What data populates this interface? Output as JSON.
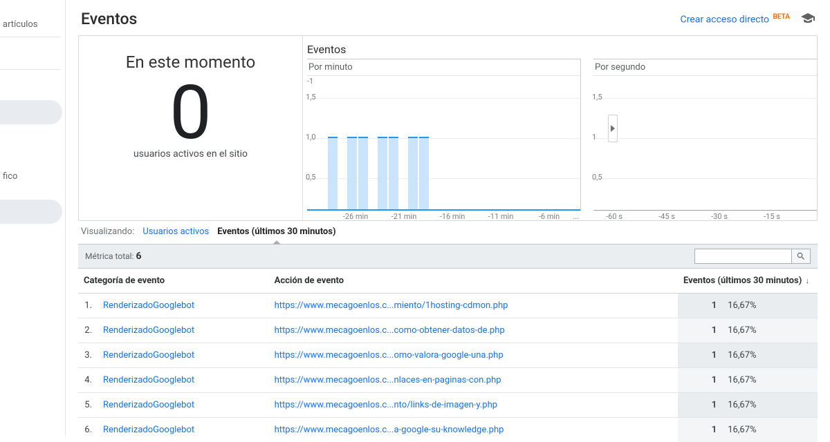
{
  "sidebar": {
    "item_articles": "artículos",
    "item_traffic": "fico"
  },
  "header": {
    "title": "Eventos",
    "shortcut": "Crear acceso directo",
    "beta": "BETA"
  },
  "realtime": {
    "title": "En este momento",
    "count": "0",
    "sub": "usuarios activos en el sitio"
  },
  "charts": {
    "heading": "Eventos",
    "per_minute": "Por minuto",
    "per_second": "Por segundo",
    "y15": "1,5",
    "y10": "1,0",
    "y05": "0,5",
    "y1": "1",
    "ym1": "-1",
    "min_ticks": [
      "-26 min",
      "-21 min",
      "-16 min",
      "-11 min",
      "-6 min"
    ],
    "sec_ticks": [
      "-60 s",
      "-45 s",
      "-30 s",
      "-15 s"
    ]
  },
  "viewing": {
    "label": "Visualizando:",
    "tab_users": "Usuarios activos",
    "tab_events": "Eventos (últimos 30 minutos)"
  },
  "metric": {
    "label": "Métrica total:",
    "value": "6"
  },
  "table": {
    "col_category": "Categoría de evento",
    "col_action": "Acción de evento",
    "col_events": "Eventos (últimos 30 minutos)",
    "rows": [
      {
        "idx": "1.",
        "cat": "RenderizadoGooglebot",
        "act": "https://www.mecagoenlos.c...miento/1hosting-cdmon.php",
        "n": "1",
        "pct": "16,67%"
      },
      {
        "idx": "2.",
        "cat": "RenderizadoGooglebot",
        "act": "https://www.mecagoenlos.c...como-obtener-datos-de.php",
        "n": "1",
        "pct": "16,67%"
      },
      {
        "idx": "3.",
        "cat": "RenderizadoGooglebot",
        "act": "https://www.mecagoenlos.c...omo-valora-google-una.php",
        "n": "1",
        "pct": "16,67%"
      },
      {
        "idx": "4.",
        "cat": "RenderizadoGooglebot",
        "act": "https://www.mecagoenlos.c...nlaces-en-paginas-con.php",
        "n": "1",
        "pct": "16,67%"
      },
      {
        "idx": "5.",
        "cat": "RenderizadoGooglebot",
        "act": "https://www.mecagoenlos.c...nto/links-de-imagen-y.php",
        "n": "1",
        "pct": "16,67%"
      },
      {
        "idx": "6.",
        "cat": "RenderizadoGooglebot",
        "act": "https://www.mecagoenlos.c...a-google-su-knowledge.php",
        "n": "1",
        "pct": "16,67%"
      }
    ]
  },
  "chart_data": {
    "type": "bar",
    "title": "Eventos por minuto",
    "xlabel": "min",
    "ylabel": "Eventos",
    "ylim": [
      0,
      1.5
    ],
    "categories": [
      "-30",
      "-29",
      "-28",
      "-27",
      "-26",
      "-25",
      "-24",
      "-23",
      "-22",
      "-21",
      "-20",
      "-19",
      "-18",
      "-17",
      "-16",
      "-15",
      "-14",
      "-13",
      "-12",
      "-11",
      "-10",
      "-9",
      "-8",
      "-7",
      "-6",
      "-5",
      "-4",
      "-3",
      "-2",
      "-1"
    ],
    "values": [
      0,
      1,
      0,
      1,
      1,
      0,
      1,
      1,
      0,
      1,
      1,
      0,
      0,
      0,
      0,
      0,
      0,
      0,
      0,
      0,
      0,
      0,
      0,
      0,
      0,
      0,
      0,
      0,
      0,
      0
    ]
  }
}
